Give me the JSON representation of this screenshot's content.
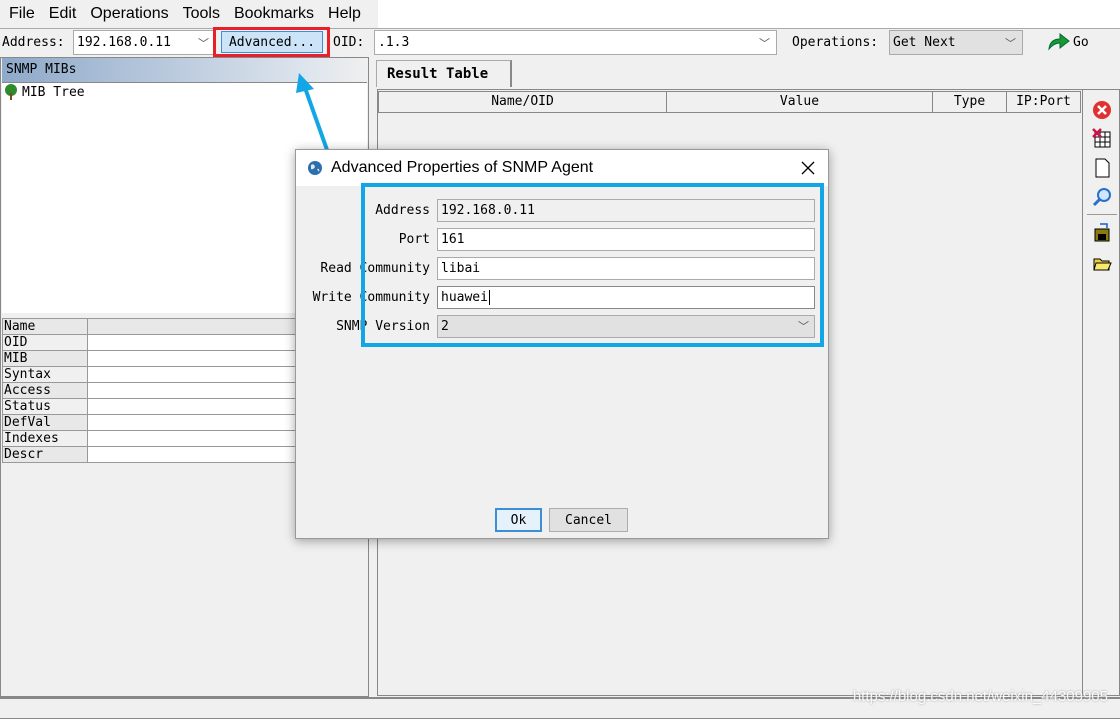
{
  "menu": [
    "File",
    "Edit",
    "Operations",
    "Tools",
    "Bookmarks",
    "Help"
  ],
  "toolbar": {
    "address_label": "Address:",
    "address_value": "192.168.0.11",
    "advanced_label": "Advanced...",
    "oid_label": "OID:",
    "oid_value": ".1.3",
    "operations_label": "Operations:",
    "operation_value": "Get Next",
    "go_label": "Go"
  },
  "left": {
    "header": "SNMP MIBs",
    "tree_root": "MIB Tree",
    "properties": [
      "Name",
      "OID",
      "MIB",
      "Syntax",
      "Access",
      "Status",
      "DefVal",
      "Indexes",
      "Descr"
    ]
  },
  "result": {
    "tab": "Result Table",
    "columns": [
      "Name/OID",
      "Value",
      "Type",
      "IP:Port"
    ]
  },
  "right_toolbar": [
    "stop-icon",
    "clear-table-icon",
    "document-icon",
    "search-icon",
    "save-icon",
    "open-folder-icon"
  ],
  "dialog": {
    "title": "Advanced Properties of SNMP Agent",
    "fields": [
      {
        "label": "Address",
        "value": "192.168.0.11"
      },
      {
        "label": "Port",
        "value": "161"
      },
      {
        "label": "Read Community",
        "value": "libai"
      },
      {
        "label": "Write Community",
        "value": "huawei"
      },
      {
        "label": "SNMP Version",
        "value": "2"
      }
    ],
    "ok": "Ok",
    "cancel": "Cancel"
  },
  "annotation_colors": {
    "red_box": "#e8202a",
    "blue_box": "#12a6e6"
  },
  "watermark": "https://blog.csdn.net/weixin_44309905"
}
